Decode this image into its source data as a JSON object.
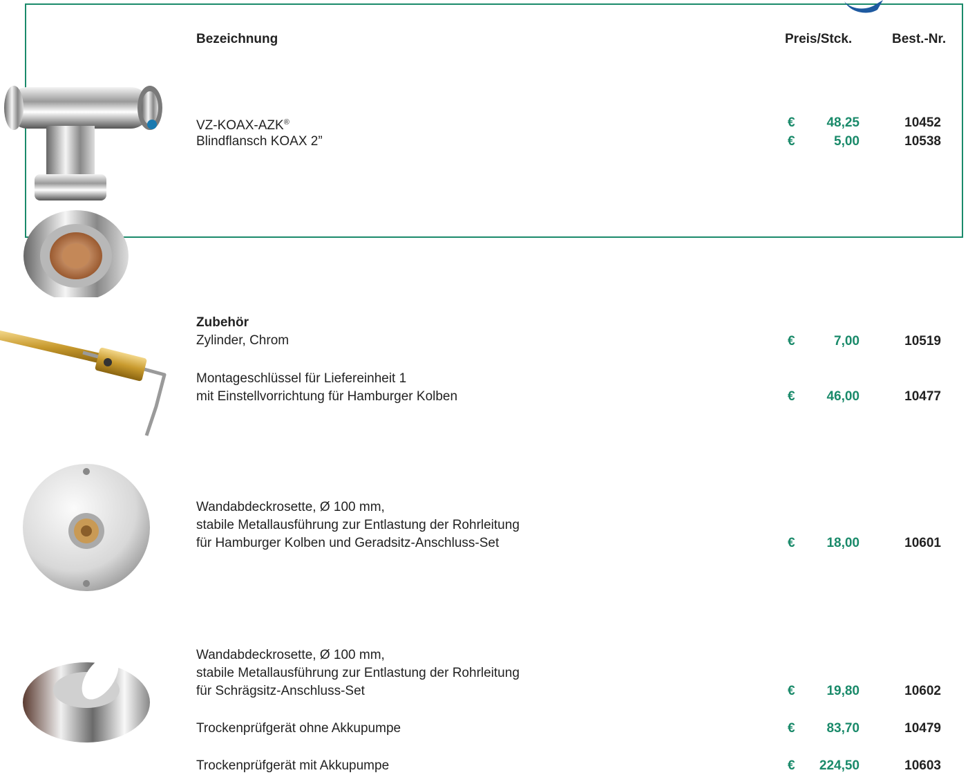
{
  "header": {
    "name_label": "Bezeichnung",
    "price_label": "Preis/Stck.",
    "artno_label": "Best.-Nr."
  },
  "currency": "€",
  "products": [
    {
      "line_main": "VZ-KOAX-AZK",
      "line_sup": "®",
      "price": "48,25",
      "artno": "10452"
    },
    {
      "line_main": "Blindflansch KOAX 2”",
      "price": "5,00",
      "artno": "10538"
    }
  ],
  "accessories": {
    "title": "Zubehör",
    "items": [
      {
        "lines": [
          "Zylinder, Chrom"
        ],
        "price": "7,00",
        "artno": "10519"
      },
      {
        "lines": [
          "Montageschlüssel für Liefereinheit 1",
          "mit Einstellvorrichtung für Hamburger Kolben"
        ],
        "price": "46,00",
        "artno": "10477"
      },
      {
        "lines": [
          "Wandabdeckrosette, Ø 100 mm,",
          "stabile Metallausführung zur Entlastung der Rohrleitung",
          "für Hamburger Kolben und Geradsitz-Anschluss-Set"
        ],
        "price": "18,00",
        "artno": "10601"
      },
      {
        "lines": [
          "Wandabdeckrosette, Ø 100 mm,",
          "stabile Metallausführung zur Entlastung der Rohrleitung",
          "für Schrägsitz-Anschluss-Set"
        ],
        "price": "19,80",
        "artno": "10602"
      },
      {
        "lines": [
          "Trockenprüfgerät ohne Akkupumpe"
        ],
        "price": "83,70",
        "artno": "10479"
      },
      {
        "lines": [
          "Trockenprüfgerät mit Akkupumpe"
        ],
        "price": "224,50",
        "artno": "10603"
      }
    ]
  },
  "colors": {
    "accent": "#1a8a6a",
    "text": "#222222",
    "logo": "#1e5aa0"
  },
  "icons": [
    "brand-logo-icon",
    "koax-fitting-image",
    "cylinder-key-image",
    "wall-rosette-straight-image",
    "wall-rosette-angled-image"
  ]
}
